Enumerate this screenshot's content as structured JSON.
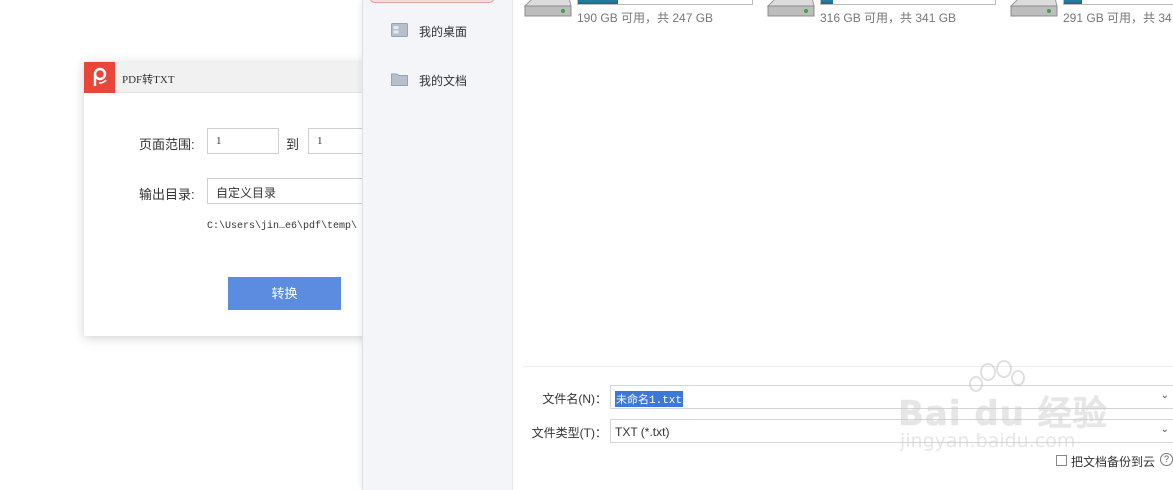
{
  "pdf_dialog": {
    "title": "PDF转TXT",
    "page_range_label": "页面范围:",
    "page_from": "1",
    "to_label": "到",
    "page_to": "1",
    "output_dir_label": "输出目录:",
    "output_dir_value": "自定义目录",
    "output_path": "C:\\Users\\jin…e6\\pdf\\temp\\",
    "convert_label": "转换",
    "accent_color": "#e8463a",
    "button_color": "#5b8ce0"
  },
  "save_dialog": {
    "nav": [
      {
        "label": "我的桌面",
        "icon": "desktop-icon"
      },
      {
        "label": "我的文档",
        "icon": "folder-icon"
      }
    ],
    "drives": [
      {
        "caption": "190 GB 可用，共 247 GB",
        "used_fraction": 0.23,
        "icon": "hard-drive-icon"
      },
      {
        "caption": "316 GB 可用，共 341 GB",
        "used_fraction": 0.07,
        "icon": "hard-drive-icon"
      },
      {
        "caption": "291 GB 可用，共 34",
        "used_fraction": 0.15,
        "icon": "hard-drive-icon"
      }
    ],
    "filename_label": "文件名(N)：",
    "filename_value": "未命名1.txt",
    "filetype_label": "文件类型(T)：",
    "filetype_value": "TXT (*.txt)",
    "backup_label": "把文档备份到云",
    "selection_color": "#3b79d8"
  },
  "watermark": {
    "brand": "Bai du 经验",
    "url": "jingyan.baidu.com"
  }
}
